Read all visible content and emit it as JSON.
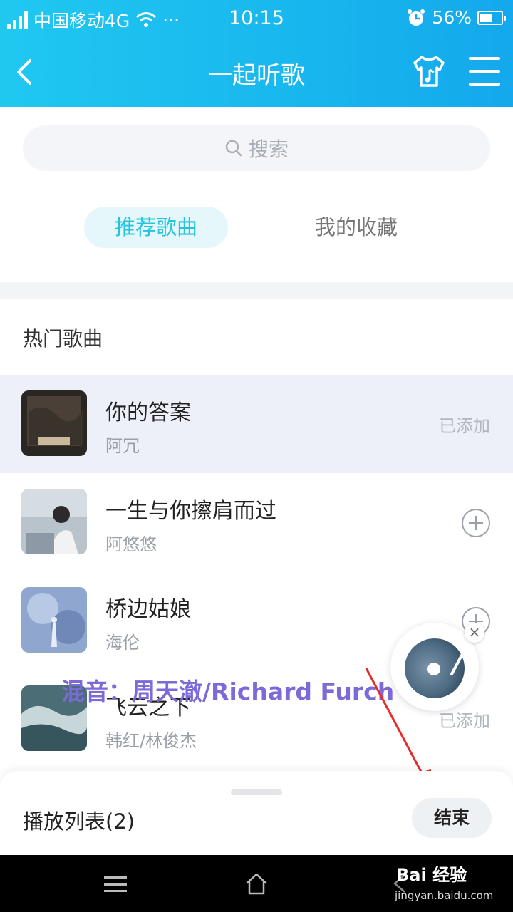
{
  "status_bar": {
    "carrier": "中国移动4G",
    "dots": "···",
    "time": "10:15",
    "battery": "56%",
    "battery_level": 0.56
  },
  "header": {
    "title": "一起听歌"
  },
  "search": {
    "placeholder": "搜索"
  },
  "tabs": [
    {
      "label": "推荐歌曲",
      "active": true
    },
    {
      "label": "我的收藏",
      "active": false
    }
  ],
  "section": {
    "title": "热门歌曲"
  },
  "songs": [
    {
      "title": "你的答案",
      "artist": "阿冗",
      "status": "已添加"
    },
    {
      "title": "一生与你擦肩而过",
      "artist": "阿悠悠",
      "status": ""
    },
    {
      "title": "桥边姑娘",
      "artist": "海伦",
      "status": ""
    },
    {
      "title": "飞云之下",
      "artist": "韩红/林俊杰",
      "status": "已添加"
    }
  ],
  "overlay": {
    "mix_credit": "混音：周天澈/Richard Furch"
  },
  "bottom": {
    "playlist": "播放列表(2)",
    "end_button": "结束"
  },
  "watermark": {
    "brand": "Bai 经验",
    "url": "jingyan.baidu.com"
  },
  "colors": {
    "accent": "#22c4e0",
    "header_start": "#20c8f0",
    "header_end": "#14a8ec",
    "highlight_row": "#edf0f8"
  }
}
